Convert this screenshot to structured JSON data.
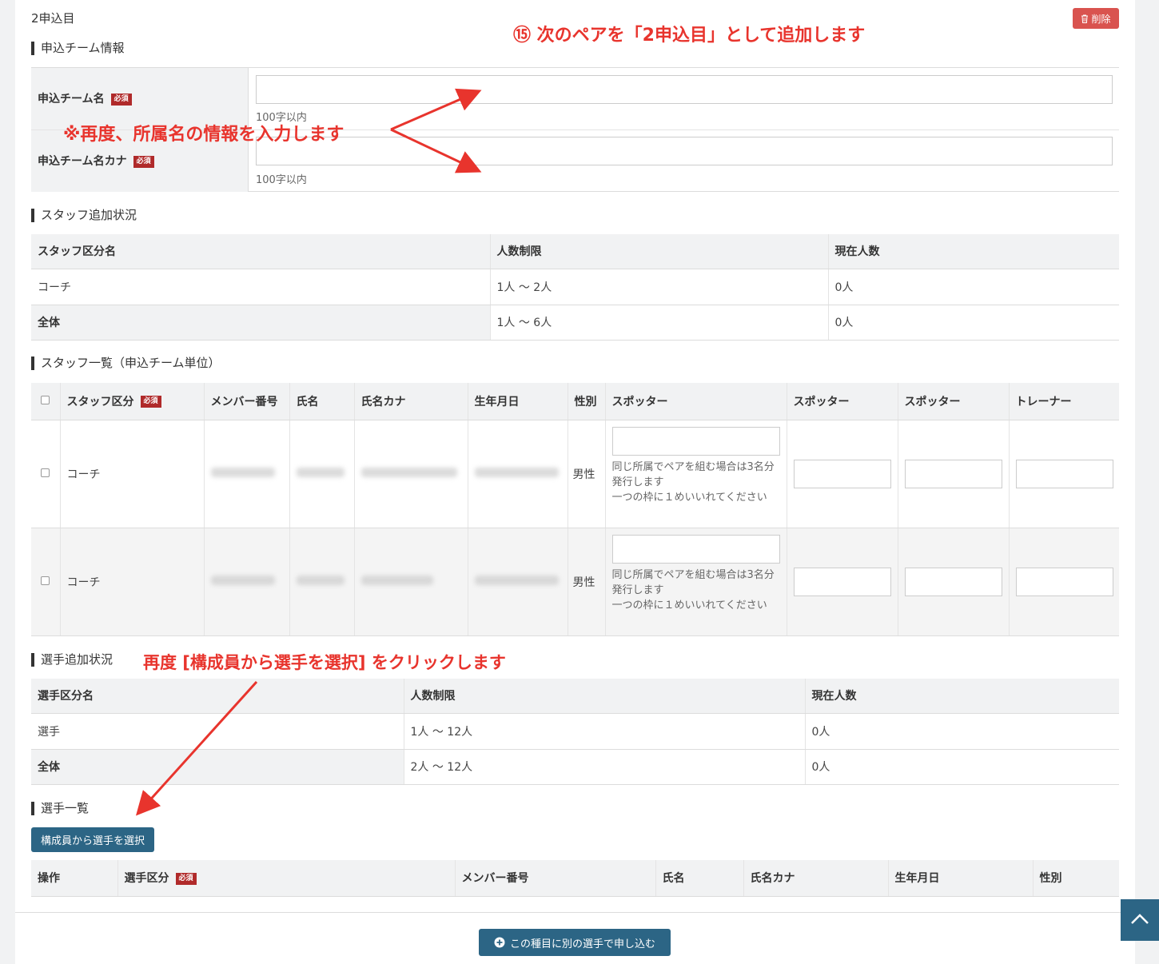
{
  "entry": {
    "title": "2申込目",
    "delete_label": "削除"
  },
  "annotations": {
    "next_pair": "⑮ 次のペアを「2申込目」として追加します",
    "reenter_affiliation": "※再度、所属名の情報を入力します",
    "click_select": "再度 [構成員から選手を選択] をクリックします"
  },
  "team_info": {
    "title": "申込チーム情報",
    "required_badge": "必須",
    "rows": [
      {
        "label": "申込チーム名",
        "value": "",
        "hint": "100字以内"
      },
      {
        "label": "申込チーム名カナ",
        "value": "",
        "hint": "100字以内"
      }
    ]
  },
  "staff_status": {
    "title": "スタッフ追加状況",
    "headers": [
      "スタッフ区分名",
      "人数制限",
      "現在人数"
    ],
    "rows": [
      [
        "コーチ",
        "1人 〜 2人",
        "0人"
      ],
      [
        "全体",
        "1人 〜 6人",
        "0人"
      ]
    ]
  },
  "staff_list": {
    "title": "スタッフ一覧（申込チーム単位）",
    "headers": [
      "スタッフ区分",
      "メンバー番号",
      "氏名",
      "氏名カナ",
      "生年月日",
      "性別",
      "スポッター",
      "スポッター",
      "スポッター",
      "トレーナー"
    ],
    "rows": [
      {
        "category": "コーチ",
        "gender": "男性",
        "note": "同じ所属でペアを組む場合は3名分発行します\n一つの枠に１めいいれてください"
      },
      {
        "category": "コーチ",
        "gender": "男性",
        "note": "同じ所属でペアを組む場合は3名分発行します\n一つの枠に１めいいれてください"
      }
    ]
  },
  "player_status": {
    "title": "選手追加状況",
    "headers": [
      "選手区分名",
      "人数制限",
      "現在人数"
    ],
    "rows": [
      [
        "選手",
        "1人 〜 12人",
        "0人"
      ],
      [
        "全体",
        "2人 〜 12人",
        "0人"
      ]
    ]
  },
  "player_list": {
    "title": "選手一覧",
    "select_button": "構成員から選手を選択",
    "headers": [
      "操作",
      "選手区分",
      "メンバー番号",
      "氏名",
      "氏名カナ",
      "生年月日",
      "性別"
    ]
  },
  "footer": {
    "apply_other_label": "この種目に別の選手で申し込む"
  }
}
